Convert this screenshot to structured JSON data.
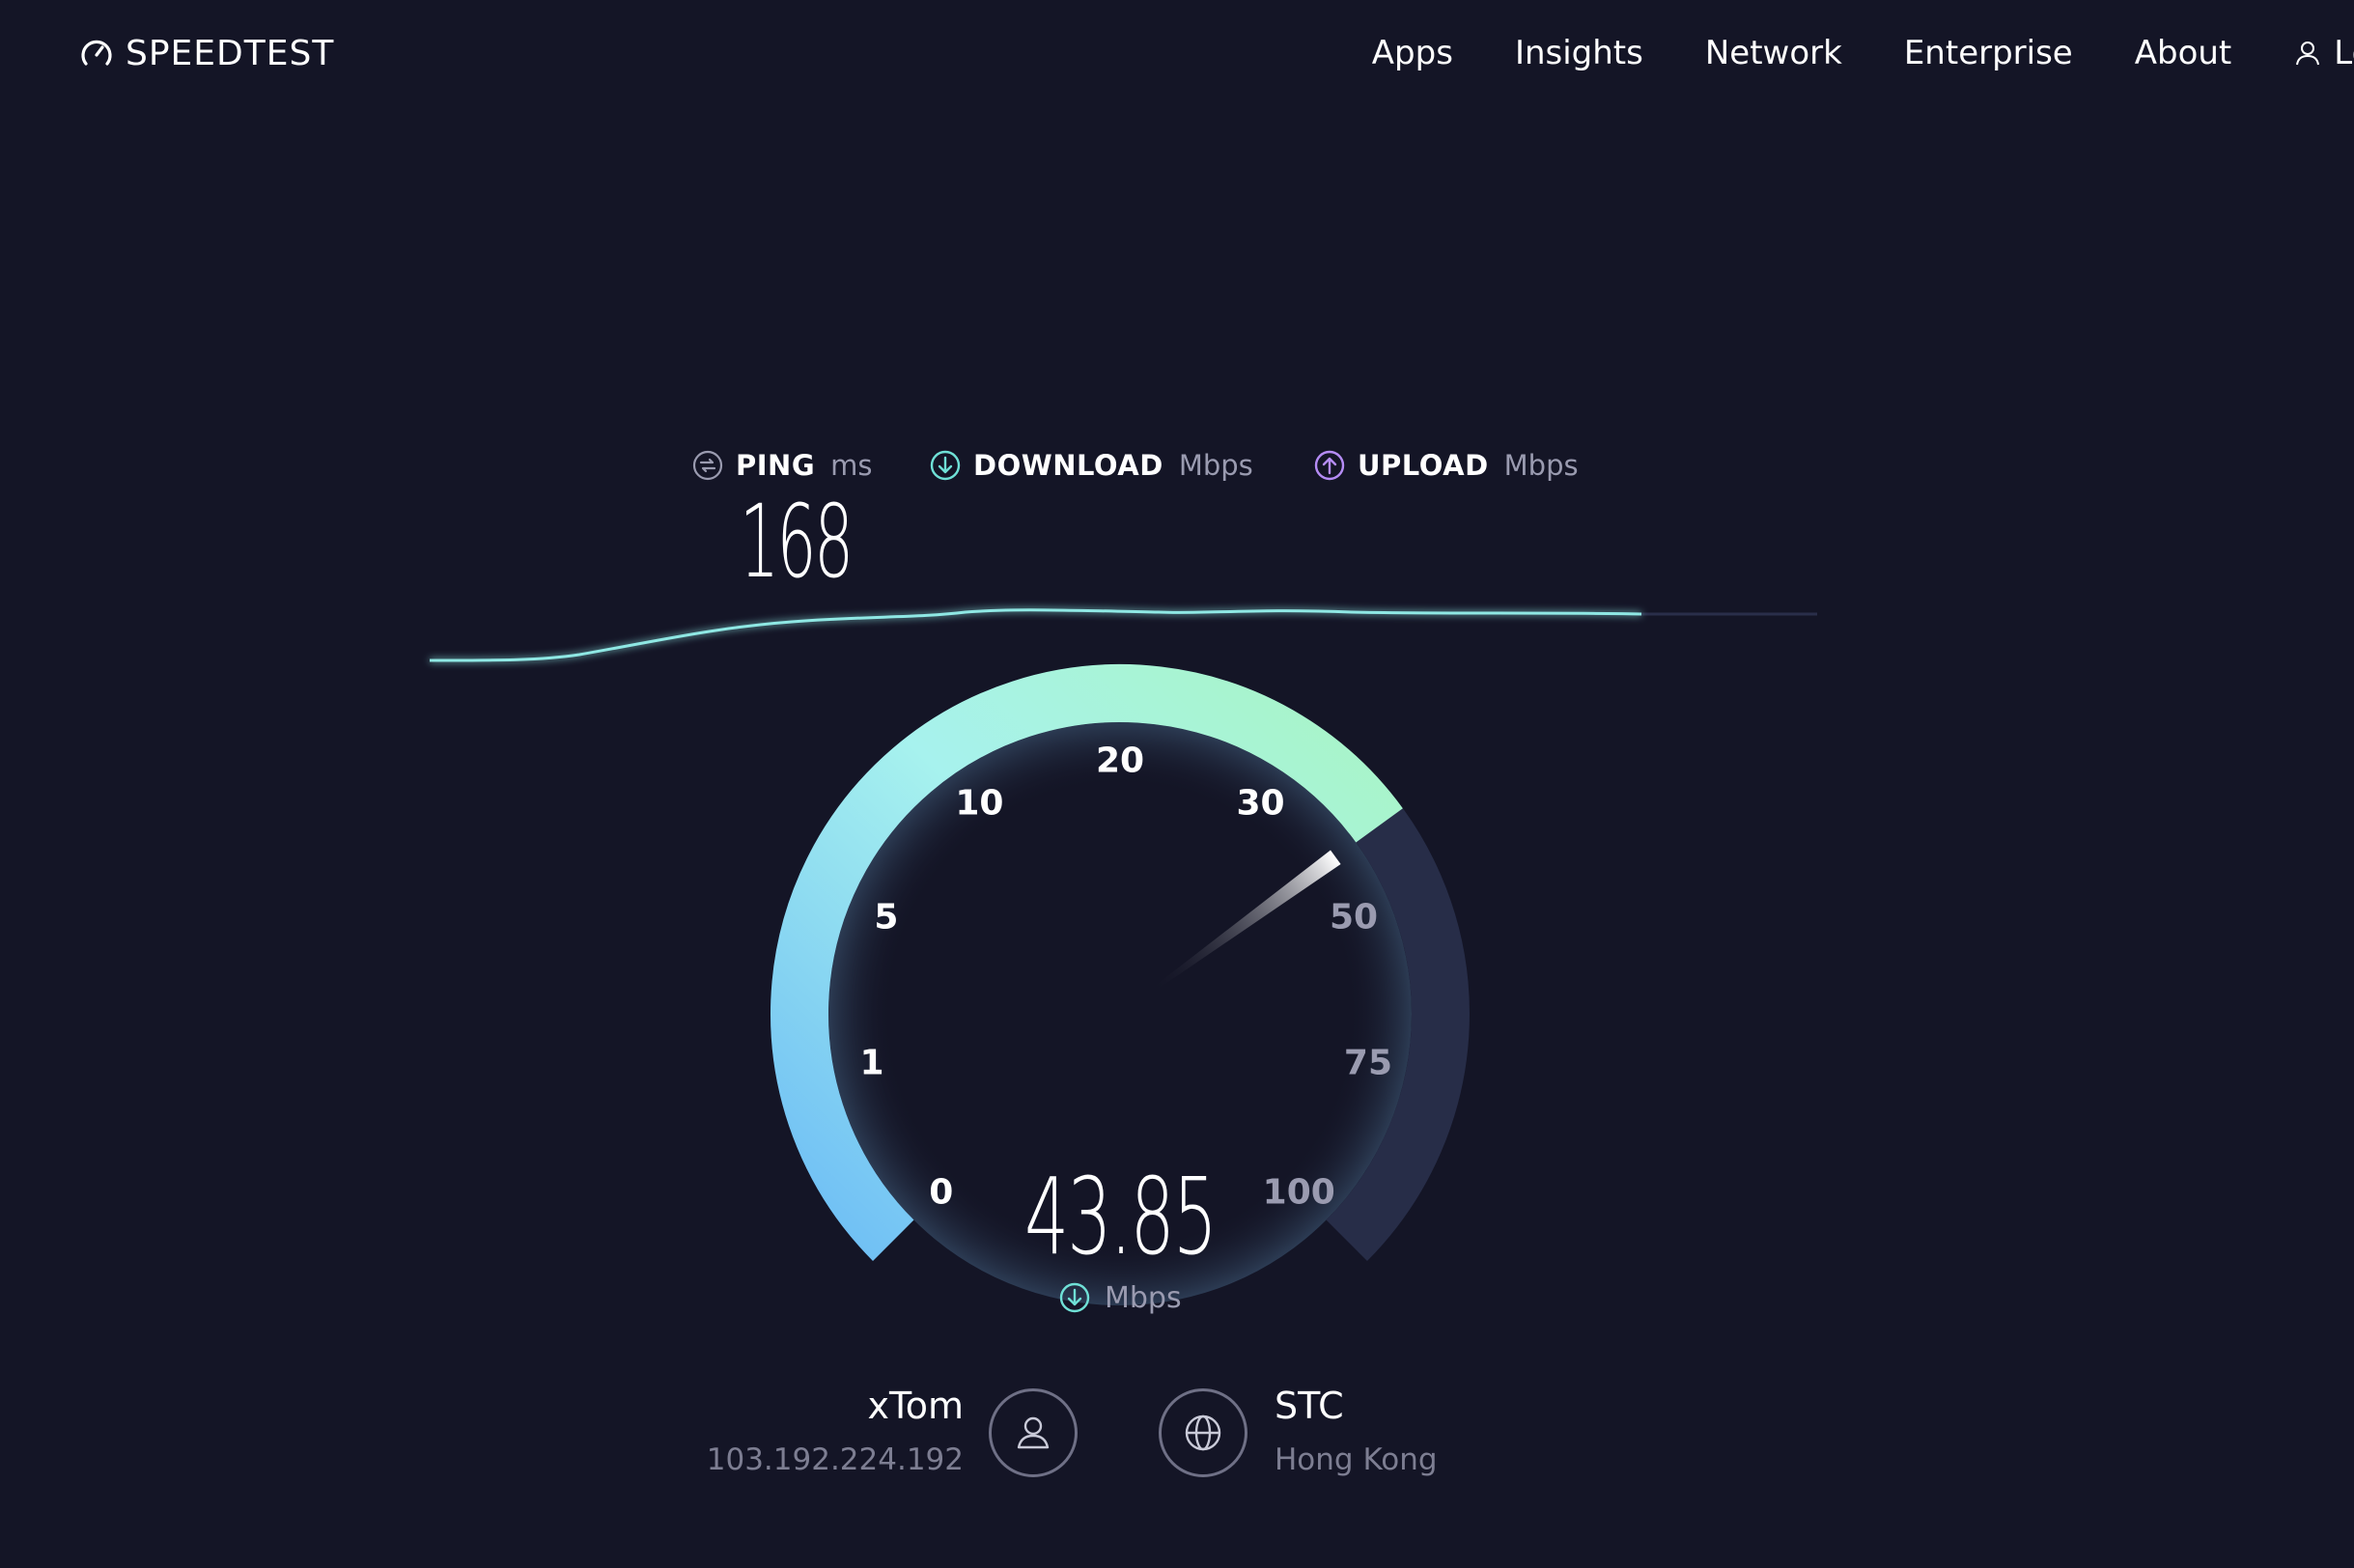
{
  "header": {
    "logo_text": "SPEEDTEST",
    "nav": [
      "Apps",
      "Insights",
      "Network",
      "Enterprise",
      "About"
    ],
    "login_label": "Log"
  },
  "metrics": {
    "ping": {
      "label": "PING",
      "unit": "ms",
      "value": "168"
    },
    "download": {
      "label": "DOWNLOAD",
      "unit": "Mbps"
    },
    "upload": {
      "label": "UPLOAD",
      "unit": "Mbps"
    }
  },
  "gauge": {
    "ticks": [
      "0",
      "1",
      "5",
      "10",
      "20",
      "30",
      "50",
      "75",
      "100"
    ],
    "current_value": "43.85",
    "unit": "Mbps",
    "progress_tick_index": 5.6
  },
  "isp": {
    "name": "xTom",
    "ip": "103.192.224.192"
  },
  "server": {
    "name": "STC",
    "location": "Hong Kong"
  },
  "colors": {
    "background": "#141526",
    "gauge_start": "#6cc0f5",
    "gauge_mid": "#a7f2e8",
    "gauge_end": "#a9f5c4",
    "gauge_track": "#272d48",
    "download_icon": "#6fe0d6",
    "upload_icon": "#b58cf5"
  },
  "icons": {
    "logo": "gauge-icon",
    "login": "user-icon",
    "ping": "ping-icon",
    "download": "download-icon",
    "upload": "upload-icon",
    "isp": "user-icon",
    "server": "globe-icon"
  }
}
